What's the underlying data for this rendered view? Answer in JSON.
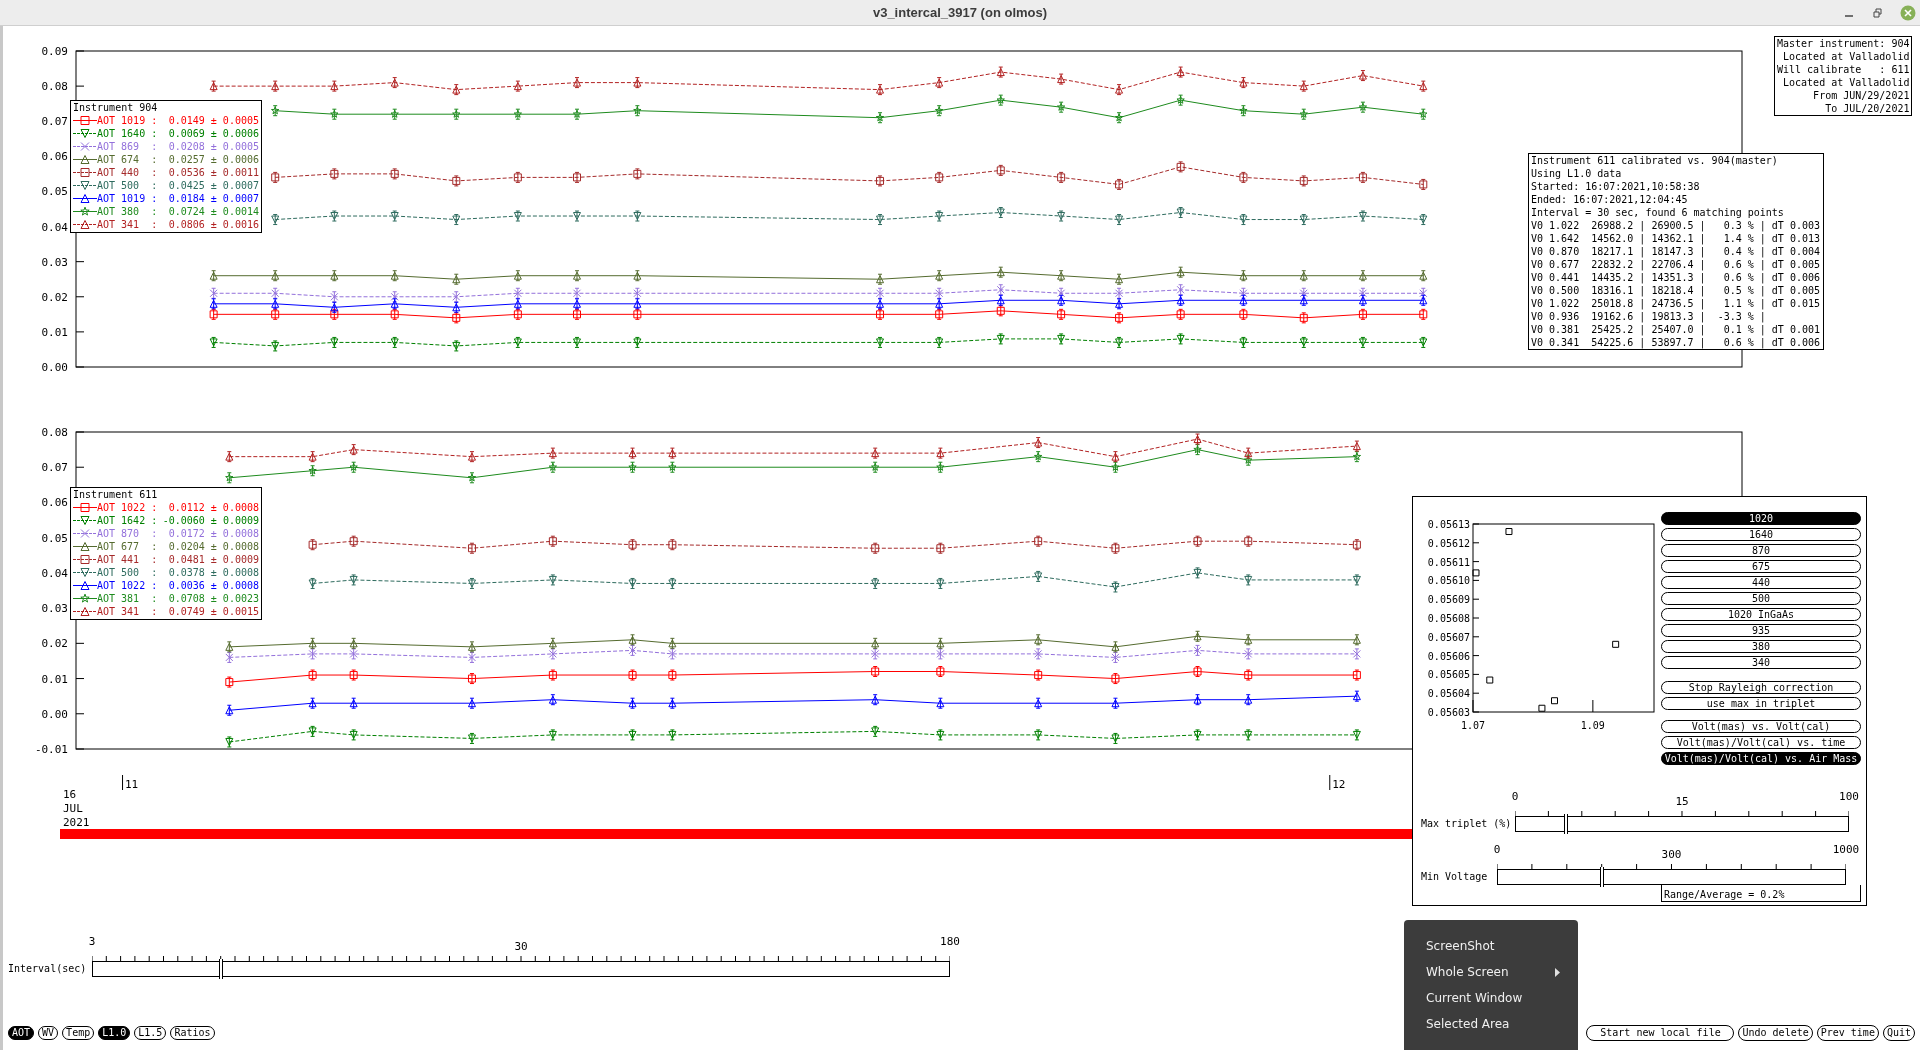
{
  "window": {
    "title": "v3_intercal_3917 (on olmos)"
  },
  "top_chart": {
    "chart_data": {
      "type": "line",
      "xlim": [
        10.954,
        12.334
      ],
      "ylim": [
        0,
        0.09
      ],
      "yticks": [
        {
          "value": 0,
          "label": "0.00"
        },
        {
          "value": 0.01,
          "label": "0.01"
        },
        {
          "value": 0.02,
          "label": "0.02"
        },
        {
          "value": 0.03,
          "label": "0.03"
        },
        {
          "value": 0.04,
          "label": "0.04"
        },
        {
          "value": 0.05,
          "label": "0.05"
        },
        {
          "value": 0.06,
          "label": "0.06"
        },
        {
          "value": 0.07,
          "label": "0.07"
        },
        {
          "value": 0.08,
          "label": "0.08"
        },
        {
          "value": 0.09,
          "label": "0.09"
        }
      ],
      "x": [
        11.068,
        11.119,
        11.168,
        11.218,
        11.269,
        11.32,
        11.369,
        11.419,
        11.62,
        11.669,
        11.72,
        11.77,
        11.818,
        11.869,
        11.921,
        11.971,
        12.02,
        12.07
      ],
      "series": [
        {
          "color": "#ff0000",
          "marker": "square",
          "values": [
            0.015,
            0.015,
            0.015,
            0.015,
            0.014,
            0.015,
            0.015,
            0.015,
            0.015,
            0.015,
            0.016,
            0.015,
            0.014,
            0.015,
            0.015,
            0.014,
            0.015,
            0.015
          ]
        },
        {
          "color": "#008000",
          "marker": "triangle",
          "values": [
            0.007,
            0.006,
            0.007,
            0.007,
            0.006,
            0.007,
            0.007,
            0.007,
            0.007,
            0.007,
            0.008,
            0.008,
            0.007,
            0.008,
            0.007,
            0.007,
            0.007,
            0.007
          ]
        },
        {
          "color": "#9370db",
          "marker": "cross",
          "values": [
            0.021,
            0.021,
            0.02,
            0.02,
            0.02,
            0.021,
            0.021,
            0.021,
            0.021,
            0.021,
            0.022,
            0.021,
            0.021,
            0.022,
            0.021,
            0.021,
            0.021,
            0.021
          ]
        },
        {
          "color": "#556b2f",
          "marker": "triangle",
          "values": [
            0.026,
            0.026,
            0.026,
            0.026,
            0.025,
            0.026,
            0.026,
            0.026,
            0.025,
            0.026,
            0.027,
            0.026,
            0.025,
            0.027,
            0.026,
            0.026,
            0.026,
            0.026
          ]
        },
        {
          "color": "#a52a2a",
          "marker": "square",
          "values": [
            null,
            0.054,
            0.055,
            0.055,
            0.053,
            0.054,
            0.054,
            0.055,
            0.053,
            0.054,
            0.056,
            0.054,
            0.052,
            0.057,
            0.054,
            0.053,
            0.054,
            0.052
          ]
        },
        {
          "color": "#2e6b5e",
          "marker": "triangle",
          "values": [
            null,
            0.042,
            0.043,
            0.043,
            0.042,
            0.043,
            0.043,
            0.043,
            0.042,
            0.043,
            0.044,
            0.043,
            0.042,
            0.044,
            0.042,
            0.042,
            0.043,
            0.042
          ]
        },
        {
          "color": "#0000ff",
          "marker": "triangle",
          "values": [
            0.018,
            0.018,
            0.017,
            0.018,
            0.017,
            0.018,
            0.018,
            0.018,
            0.018,
            0.018,
            0.019,
            0.019,
            0.018,
            0.019,
            0.019,
            0.019,
            0.019,
            0.019
          ]
        },
        {
          "color": "#1e8b1e",
          "marker": "star",
          "values": [
            null,
            0.073,
            0.072,
            0.072,
            0.072,
            0.072,
            0.072,
            0.073,
            0.071,
            0.073,
            0.076,
            0.074,
            0.071,
            0.076,
            0.073,
            0.072,
            0.074,
            0.072
          ]
        },
        {
          "color": "#b22222",
          "marker": "triangle",
          "values": [
            0.08,
            0.08,
            0.08,
            0.081,
            0.079,
            0.08,
            0.081,
            0.081,
            0.079,
            0.081,
            0.084,
            0.082,
            0.079,
            0.084,
            0.081,
            0.08,
            0.083,
            0.08
          ]
        }
      ]
    },
    "legend": {
      "title": "Instrument 904",
      "items": [
        {
          "label": "AOT 1019 :",
          "value": "0.0149 ± 0.0005",
          "dashed": false
        },
        {
          "label": "AOT 1640 :",
          "value": "0.0069 ± 0.0006",
          "dashed": true,
          "inverted": true
        },
        {
          "label": "AOT 869  :",
          "value": "0.0208 ± 0.0005",
          "dashed": true
        },
        {
          "label": "AOT 674  :",
          "value": "0.0257 ± 0.0006",
          "dashed": false,
          "inverted": false
        },
        {
          "label": "AOT 440  :",
          "value": "0.0536 ± 0.0011",
          "dashed": true
        },
        {
          "label": "AOT 500  :",
          "value": "0.0425 ± 0.0007",
          "dashed": true,
          "inverted": true
        },
        {
          "label": "AOT 1019 :",
          "value": "0.0184 ± 0.0007",
          "dashed": false,
          "inverted": false
        },
        {
          "label": "AOT 380  :",
          "value": "0.0724 ± 0.0014",
          "dashed": false
        },
        {
          "label": "AOT 341  :",
          "value": "0.0806 ± 0.0016",
          "dashed": true,
          "inverted": false
        }
      ]
    }
  },
  "bottom_chart": {
    "chart_data": {
      "type": "line",
      "xlim": [
        10.954,
        12.334
      ],
      "ylim": [
        -0.01,
        0.08
      ],
      "xticks": [
        {
          "value": 11,
          "label": "11"
        },
        {
          "value": 12,
          "label": "12"
        }
      ],
      "yticks": [
        {
          "value": -0.01,
          "label": "-0.01"
        },
        {
          "value": 0,
          "label": "0.00"
        },
        {
          "value": 0.01,
          "label": "0.01"
        },
        {
          "value": 0.02,
          "label": "0.02"
        },
        {
          "value": 0.03,
          "label": "0.03"
        },
        {
          "value": 0.04,
          "label": "0.04"
        },
        {
          "value": 0.05,
          "label": "0.05"
        },
        {
          "value": 0.06,
          "label": "0.06"
        },
        {
          "value": 0.07,
          "label": "0.07"
        },
        {
          "value": 0.08,
          "label": "0.08"
        }
      ],
      "x": [
        11.081,
        11.15,
        11.184,
        11.282,
        11.349,
        11.415,
        11.448,
        11.616,
        11.67,
        11.751,
        11.815,
        11.883,
        11.925,
        12.015
      ],
      "series": [
        {
          "color": "#ff0000",
          "marker": "square",
          "values": [
            0.009,
            0.011,
            0.011,
            0.01,
            0.011,
            0.011,
            0.011,
            0.012,
            0.012,
            0.011,
            0.01,
            0.012,
            0.011,
            0.011
          ]
        },
        {
          "color": "#008000",
          "marker": "triangle",
          "values": [
            -0.008,
            -0.005,
            -0.006,
            -0.007,
            -0.006,
            -0.006,
            -0.006,
            -0.005,
            -0.006,
            -0.006,
            -0.007,
            -0.006,
            -0.006,
            -0.006
          ]
        },
        {
          "color": "#9370db",
          "marker": "cross",
          "values": [
            0.016,
            0.017,
            0.017,
            0.016,
            0.017,
            0.018,
            0.017,
            0.017,
            0.017,
            0.017,
            0.016,
            0.018,
            0.017,
            0.017
          ]
        },
        {
          "color": "#556b2f",
          "marker": "triangle",
          "values": [
            0.019,
            0.02,
            0.02,
            0.019,
            0.02,
            0.021,
            0.02,
            0.02,
            0.02,
            0.021,
            0.019,
            0.022,
            0.021,
            0.021
          ]
        },
        {
          "color": "#a52a2a",
          "marker": "square",
          "values": [
            null,
            0.048,
            0.049,
            0.047,
            0.049,
            0.048,
            0.048,
            0.047,
            0.047,
            0.049,
            0.047,
            0.049,
            0.049,
            0.048
          ]
        },
        {
          "color": "#2e6b5e",
          "marker": "triangle",
          "values": [
            null,
            0.037,
            0.038,
            0.037,
            0.038,
            0.037,
            0.037,
            0.037,
            0.037,
            0.039,
            0.036,
            0.04,
            0.038,
            0.038
          ]
        },
        {
          "color": "#0000ff",
          "marker": "triangle",
          "values": [
            0.001,
            0.003,
            0.003,
            0.003,
            0.004,
            0.003,
            0.003,
            0.004,
            0.003,
            0.003,
            0.003,
            0.004,
            0.004,
            0.005
          ]
        },
        {
          "color": "#1e8b1e",
          "marker": "star",
          "values": [
            0.067,
            0.069,
            0.07,
            0.067,
            0.07,
            0.07,
            0.07,
            0.07,
            0.07,
            0.073,
            0.07,
            0.075,
            0.072,
            0.073
          ]
        },
        {
          "color": "#b22222",
          "marker": "triangle",
          "values": [
            0.073,
            0.073,
            0.075,
            0.073,
            0.074,
            0.074,
            0.074,
            0.074,
            0.074,
            0.077,
            0.073,
            0.078,
            0.074,
            0.076
          ]
        }
      ]
    },
    "legend": {
      "title": "Instrument 611",
      "items": [
        {
          "label": "AOT 1022 :",
          "value": "0.0112 ± 0.0008",
          "dashed": false
        },
        {
          "label": "AOT 1642 :",
          "value": "-0.0060 ± 0.0009",
          "dashed": true,
          "inverted": true
        },
        {
          "label": "AOT 870  :",
          "value": "0.0172 ± 0.0008",
          "dashed": true
        },
        {
          "label": "AOT 677  :",
          "value": "0.0204 ± 0.0008",
          "dashed": false,
          "inverted": false
        },
        {
          "label": "AOT 441  :",
          "value": "0.0481 ± 0.0009",
          "dashed": true
        },
        {
          "label": "AOT 500  :",
          "value": "0.0378 ± 0.0008",
          "dashed": true,
          "inverted": true
        },
        {
          "label": "AOT 1022 :",
          "value": "0.0036 ± 0.0008",
          "dashed": false,
          "inverted": false
        },
        {
          "label": "AOT 381  :",
          "value": "0.0708 ± 0.0023",
          "dashed": false
        },
        {
          "label": "AOT 341  :",
          "value": "0.0749 ± 0.0015",
          "dashed": true,
          "inverted": false
        }
      ]
    },
    "date_lines": [
      "16",
      "JUL",
      "2021"
    ]
  },
  "master_info": {
    "lines": [
      "Master instrument: 904",
      " Located at Valladolid",
      "Will calibrate   : 611",
      " Located at Valladolid",
      "      From JUN/29/2021",
      "        To JUL/20/2021"
    ]
  },
  "calibration_info": {
    "lines": [
      "Instrument 611 calibrated vs. 904(master)",
      "Using L1.0 data",
      "Started: 16:07:2021,10:58:38",
      "Ended: 16:07:2021,12:04:45",
      "Interval = 30 sec, found 6 matching points",
      "V0 1.022  26988.2 | 26900.5 |   0.3 % | dT 0.003",
      "V0 1.642  14562.0 | 14362.1 |   1.4 % | dT 0.013",
      "V0 0.870  18217.1 | 18147.3 |   0.4 % | dT 0.004",
      "V0 0.677  22832.2 | 22706.4 |   0.6 % | dT 0.005",
      "V0 0.441  14435.2 | 14351.3 |   0.6 % | dT 0.006",
      "V0 0.500  18316.1 | 18218.4 |   0.5 % | dT 0.005",
      "V0 1.022  25018.8 | 24736.5 |   1.1 % | dT 0.015",
      "V0 0.936  19162.6 | 19813.3 |  -3.3 % |",
      "V0 0.381  25425.2 | 25407.0 |   0.1 % | dT 0.001",
      "V0 0.341  54225.6 | 53897.7 |   0.6 % | dT 0.006"
    ]
  },
  "interval_slider": {
    "label": "Interval(sec)",
    "scale": [
      "3",
      "30",
      "180"
    ],
    "level": 0.15
  },
  "data_toggles": [
    {
      "label": "AOT",
      "selected": true
    },
    {
      "label": "WV",
      "selected": false
    },
    {
      "label": "Temp",
      "selected": false
    },
    {
      "label": "L1.0",
      "selected": true
    },
    {
      "label": "L1.5",
      "selected": false
    },
    {
      "label": "Ratios",
      "selected": false
    }
  ],
  "action_buttons": [
    "Start new local file",
    "Undo delete",
    "Prev time",
    "Quit"
  ],
  "side_panel": {
    "chart_data": {
      "type": "scatter",
      "xlim": [
        1.07,
        1.1002
      ],
      "ylim": [
        0.05603,
        0.05613
      ],
      "xticks": [
        {
          "value": 1.07,
          "label": "1.07"
        },
        {
          "value": 1.09,
          "label": "1.09"
        }
      ],
      "yticks": [
        {
          "value": 0.05603,
          "label": "0.05603"
        },
        {
          "value": 0.05604,
          "label": "0.05604"
        },
        {
          "value": 0.05605,
          "label": "0.05605"
        },
        {
          "value": 0.05606,
          "label": "0.05606"
        },
        {
          "value": 0.05607,
          "label": "0.05607"
        },
        {
          "value": 0.05608,
          "label": "0.05608"
        },
        {
          "value": 0.05609,
          "label": "0.05609"
        },
        {
          "value": 0.0561,
          "label": "0.05610"
        },
        {
          "value": 0.05611,
          "label": "0.05611"
        },
        {
          "value": 0.05612,
          "label": "0.05612"
        },
        {
          "value": 0.05613,
          "label": "0.05613"
        }
      ],
      "x": [
        1.0705,
        1.0728,
        1.076,
        1.0815,
        1.0836,
        1.0938
      ],
      "series": [
        {
          "color": "#000000",
          "values": [
            0.056104,
            0.056047,
            0.056126,
            0.056032,
            0.056036,
            0.056066
          ]
        }
      ]
    },
    "wavelength_buttons": [
      {
        "label": "1020",
        "selected": true
      },
      {
        "label": "1640",
        "selected": false
      },
      {
        "label": "870",
        "selected": false
      },
      {
        "label": "675",
        "selected": false
      },
      {
        "label": "440",
        "selected": false
      },
      {
        "label": "500",
        "selected": false
      },
      {
        "label": "1020 InGaAs",
        "selected": false
      },
      {
        "label": "935",
        "selected": false
      },
      {
        "label": "380",
        "selected": false
      },
      {
        "label": "340",
        "selected": false
      }
    ],
    "option_buttons": [
      {
        "label": "Stop Rayleigh correction",
        "selected": false
      },
      {
        "label": "use max in triplet",
        "selected": false
      }
    ],
    "plot_buttons": [
      {
        "label": "Volt(mas) vs. Volt(cal)",
        "selected": false
      },
      {
        "label": "Volt(mas)/Volt(cal) vs. time",
        "selected": false
      },
      {
        "label": "Volt(mas)/Volt(cal) vs. Air Mass",
        "selected": true
      }
    ],
    "summary": "Range/Average = 0.2%",
    "sliders": [
      {
        "label": "Max triplet (%)",
        "scale": [
          "0",
          "15",
          "100"
        ],
        "level": 0.15
      },
      {
        "label": "Min Voltage",
        "scale": [
          "0",
          "300",
          "1000"
        ],
        "level": 0.3
      }
    ]
  },
  "context_menu": {
    "items": [
      {
        "label": "ScreenShot",
        "has_submenu": false
      },
      {
        "label": "Whole Screen",
        "has_submenu": true
      },
      {
        "label": "Current Window",
        "has_submenu": false
      },
      {
        "label": "Selected Area",
        "has_submenu": false
      }
    ]
  }
}
